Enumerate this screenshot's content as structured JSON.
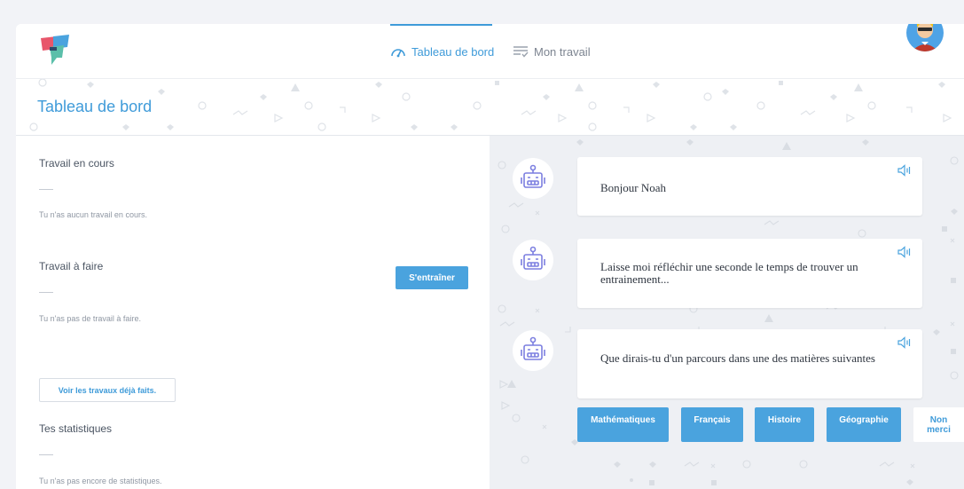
{
  "nav": {
    "dashboard_label": "Tableau de bord",
    "work_label": "Mon travail"
  },
  "header": {
    "title": "Tableau de bord"
  },
  "left": {
    "current_work": {
      "title": "Travail en cours",
      "empty_text": "Tu n'as aucun travail en cours."
    },
    "todo_work": {
      "title": "Travail à faire",
      "empty_text": "Tu n'as pas de travail à faire.",
      "train_button": "S'entraîner"
    },
    "done_button": "Voir les travaux déjà faits.",
    "stats": {
      "title": "Tes statistiques",
      "empty_text": "Tu n'as pas encore de statistiques."
    }
  },
  "chat": {
    "messages": [
      "Bonjour Noah",
      "Laisse moi réfléchir une seconde le temps de trouver un entrainement...",
      "Que dirais-tu d'un parcours dans une des matières suivantes"
    ],
    "subjects": [
      "Mathématiques",
      "Français",
      "Histoire",
      "Géographie"
    ],
    "no_thanks": "Non merci"
  },
  "colors": {
    "accent": "#3f9bd9",
    "button": "#4aa3de",
    "bot_icon": "#7c7fe0",
    "logo_red": "#e8566b",
    "logo_blue": "#4aa3de",
    "logo_teal": "#5bbfaa"
  }
}
